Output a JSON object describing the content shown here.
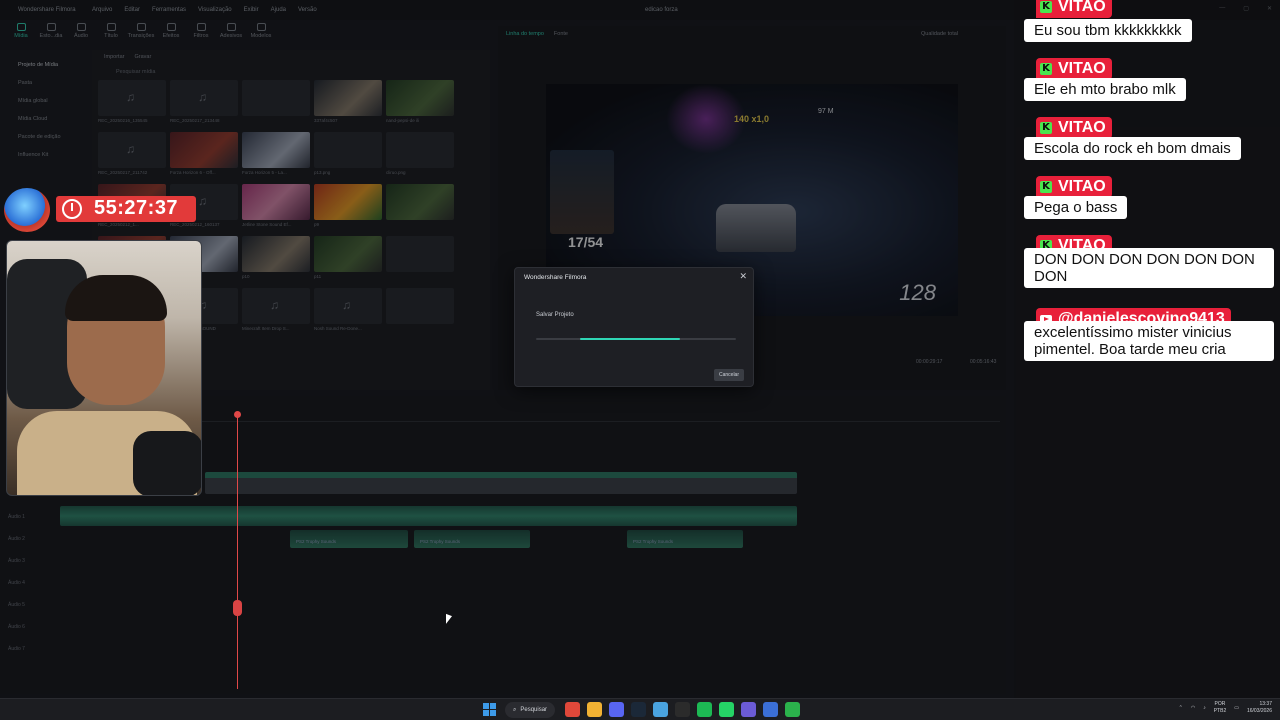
{
  "window": {
    "app_name": "Wondershare Filmora",
    "menu": [
      "Arquivo",
      "Editar",
      "Ferramentas",
      "Visualização",
      "Exibir",
      "Ajuda",
      "Versão"
    ],
    "doc_title": "edicao forza"
  },
  "toolbar": {
    "tools": [
      "Mídia",
      "Esto...dia",
      "Áudio",
      "Título",
      "Transições",
      "Efeitos",
      "Filtros",
      "Adesivos",
      "Modelos"
    ]
  },
  "sidebar": {
    "items": [
      "Projeto de Mídia",
      "Pasta",
      "Mídia global",
      "Mídia Cloud",
      "Pacote de edição",
      "Influence Kit"
    ]
  },
  "media": {
    "import_label": "Importar",
    "record_label": "Gravar",
    "search_placeholder": "Pesquisar mídia",
    "items": [
      "REC_20250216_135545",
      "REC_20250217_213448",
      "",
      "337af4c507",
      "nand-pepsi-de ili",
      "REC_20250217_211742",
      "Forza Horizon 6 - Off...",
      "Forza Horizon 5 - La...",
      "p13.png",
      "cliruo.png",
      "REC_20250212_1...",
      "REC_20250212_160137",
      "",
      "Jetline Stone Sound Ef...",
      "p9",
      "",
      "",
      "p11",
      "p10",
      "p11",
      "",
      "PS2 TROPHY SOUND",
      "",
      "Minecraft Item Drop S...",
      "Nosh Sound Re-Done..."
    ]
  },
  "preview": {
    "tab_timeline": "Linha do tempo",
    "tab_source": "Fonte",
    "quality": "Qualidade total",
    "time_current": "00:00:29:17",
    "time_total": "00:05:16:43",
    "hud_speed": "128",
    "hud_lap": "140 x1,0",
    "hud_dist": "97 M",
    "counter": "17/54"
  },
  "timeline": {
    "sfx_label": "PS2 Trophy Sounds",
    "tracks": [
      "Áudio 1",
      "Áudio 2",
      "Áudio 3",
      "Áudio 4",
      "Áudio 5",
      "Áudio 6",
      "Áudio 7"
    ]
  },
  "dialog": {
    "title": "Wondershare Filmora",
    "message": "Salvar Projeto",
    "cancel": "Cancelar",
    "progress_start": 0.22,
    "progress_end": 0.72
  },
  "overlay": {
    "timer": "55:27:37"
  },
  "chat": {
    "messages": [
      {
        "platform": "kick",
        "user": "VITAO",
        "text": "Eu sou tbm kkkkkkkkk"
      },
      {
        "platform": "kick",
        "user": "VITAO",
        "text": "Ele eh mto brabo mlk"
      },
      {
        "platform": "kick",
        "user": "VITAO",
        "text": "Escola do rock eh bom dmais"
      },
      {
        "platform": "kick",
        "user": "VITAO",
        "text": "Pega o bass"
      },
      {
        "platform": "kick",
        "user": "VITAO",
        "text": "DON DON DON DON DON DON DON"
      },
      {
        "platform": "youtube",
        "user": "@danielescovino9413",
        "text": "excelentíssimo mister vinicius pimentel. Boa tarde meu cria"
      }
    ]
  },
  "taskbar": {
    "search_label": "Pesquisar",
    "lang_top": "POR",
    "lang_bottom": "PTB2",
    "time": "13:37",
    "date": "16/03/2026",
    "app_colors": [
      "#e0483a",
      "#f2b233",
      "#5865f2",
      "#1b2838",
      "#4aa3df",
      "#2b2b2b",
      "#1db954",
      "#25d366",
      "#6b5bd6",
      "#3b6fd6",
      "#2bb24c"
    ]
  },
  "colors": {
    "accent": "#2fd6b5",
    "chat_badge": "#e8203a",
    "kick_green": "#4ae64e"
  }
}
